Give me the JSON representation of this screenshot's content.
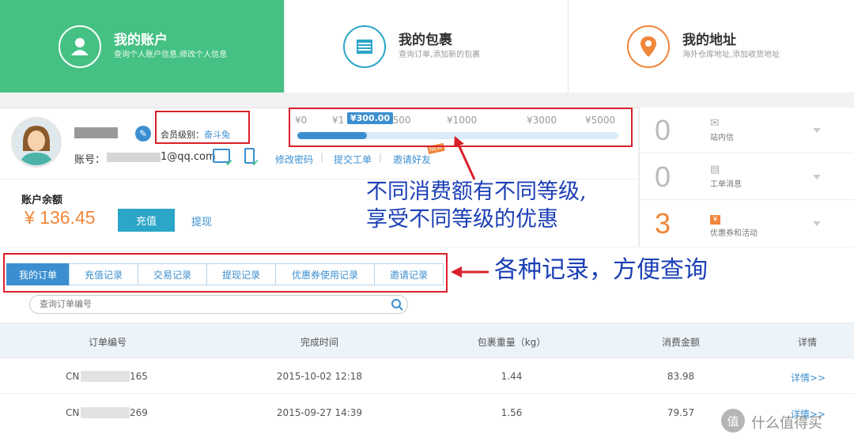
{
  "nav_cards": [
    {
      "title": "我的账户",
      "sub": "查询个人账户信息,修改个人信息"
    },
    {
      "title": "我的包裹",
      "sub": "查询订单,添加新的包裹"
    },
    {
      "title": "我的地址",
      "sub": "海外仓库地址,添加收货地址"
    }
  ],
  "profile": {
    "member_label": "会员级别：",
    "member_level": "奋斗兔",
    "account_label": "账号：",
    "account_suffix": "1@qq.com",
    "links": [
      "修改密码",
      "提交工单",
      "邀请好友"
    ],
    "new_badge": "NEW"
  },
  "levels": {
    "current": "¥300.00",
    "current_value": 300,
    "ticks": [
      "¥0",
      "¥1",
      "¥500",
      "¥1000",
      "¥3000",
      "¥5000"
    ]
  },
  "balance": {
    "label": "账户余额",
    "amount": "¥ 136.45",
    "recharge": "充值",
    "withdraw": "提现"
  },
  "stats": [
    {
      "count": "0",
      "label": "站内信",
      "color": "#bbbbbb"
    },
    {
      "count": "0",
      "label": "工单消息",
      "color": "#bbbbbb"
    },
    {
      "count": "3",
      "label": "优惠券和活动",
      "color": "#f0863a"
    }
  ],
  "annotations": {
    "levels_line1": "不同消费额有不同等级,",
    "levels_line2": "享受不同等级的优惠",
    "tabs_note": "各种记录，方便查询"
  },
  "tabs": [
    "我的订单",
    "充值记录",
    "交易记录",
    "提现记录",
    "优惠券使用记录",
    "邀请记录"
  ],
  "search": {
    "placeholder": "查询订单编号"
  },
  "table": {
    "headers": [
      "订单编号",
      "完成时间",
      "包裹重量（kg）",
      "消费金额",
      "详情"
    ],
    "rows": [
      {
        "order_prefix": "CN",
        "order_suffix": "165",
        "time": "2015-10-02 12:18",
        "weight": "1.44",
        "amount": "83.98",
        "detail": "详情>>"
      },
      {
        "order_prefix": "CN",
        "order_suffix": "269",
        "time": "2015-09-27 14:39",
        "weight": "1.56",
        "amount": "79.57",
        "detail": "详情>>"
      }
    ]
  },
  "watermark": "值 什么值得买",
  "colors": {
    "green": "#45c184",
    "blue": "#3b8fd0",
    "orange": "#f0863a",
    "red": "#d8202a",
    "annotation": "#1b3fb5"
  }
}
